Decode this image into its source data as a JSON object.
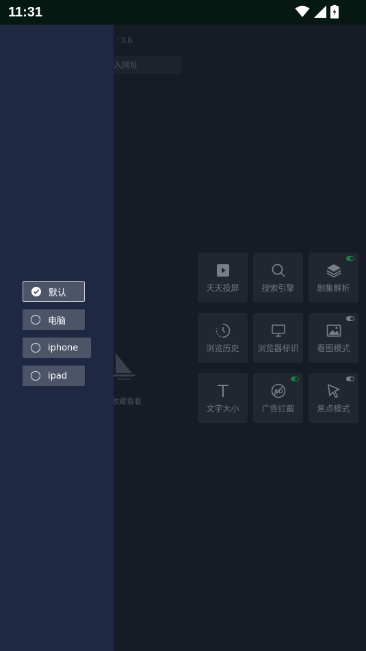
{
  "status_bar": {
    "time": "11:31"
  },
  "app": {
    "version": ": 3.6",
    "url_placeholder": "入网址",
    "empty_text": "收藏看看",
    "tiles": [
      {
        "label": "天天投屏",
        "icon": "cast-play-icon",
        "toggle": null
      },
      {
        "label": "搜索引擎",
        "icon": "search-icon",
        "toggle": null
      },
      {
        "label": "剧集解析",
        "icon": "layers-icon",
        "toggle": "on"
      },
      {
        "label": "浏览历史",
        "icon": "history-icon",
        "toggle": null
      },
      {
        "label": "浏览器标识",
        "icon": "monitor-icon",
        "toggle": null
      },
      {
        "label": "看图模式",
        "icon": "image-icon",
        "toggle": "off"
      },
      {
        "label": "文字大小",
        "icon": "text-size-icon",
        "toggle": null
      },
      {
        "label": "广告拦截",
        "icon": "ad-block-icon",
        "toggle": "on"
      },
      {
        "label": "焦点模式",
        "icon": "cursor-icon",
        "toggle": "off"
      }
    ]
  },
  "drawer": {
    "options": [
      {
        "label": "默认",
        "selected": true
      },
      {
        "label": "电脑",
        "selected": false
      },
      {
        "label": "iphone",
        "selected": false
      },
      {
        "label": "ipad",
        "selected": false
      }
    ]
  },
  "colors": {
    "drawer_bg": "#1e2843",
    "option_bg": "#4d5467",
    "toggle_on": "#1e7a4c",
    "app_bg": "#161b25"
  }
}
